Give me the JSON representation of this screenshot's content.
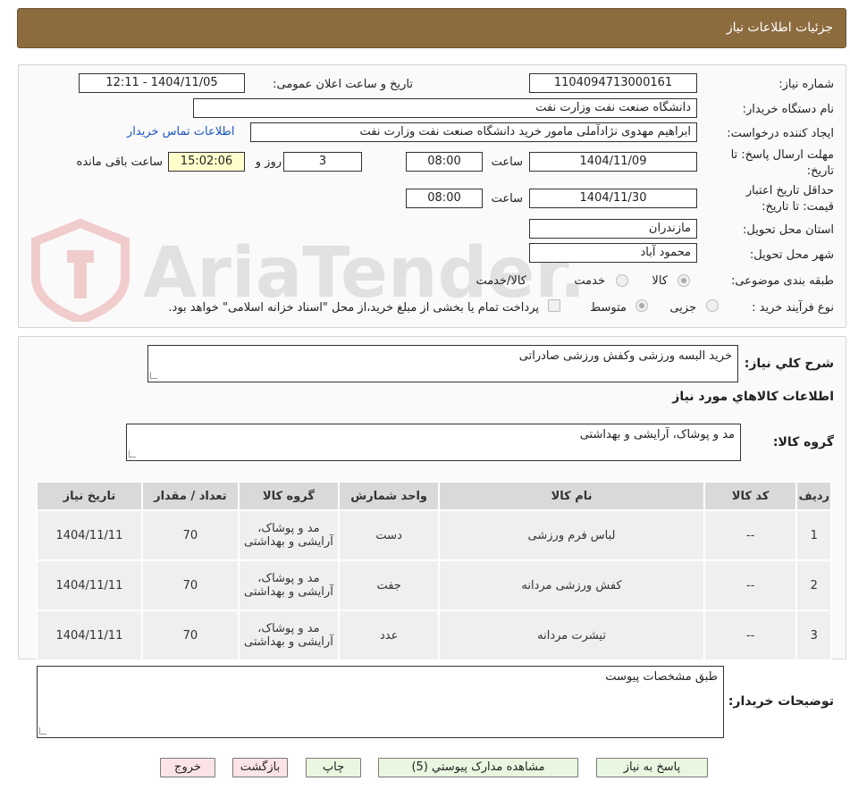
{
  "header": {
    "title": "جزئیات اطلاعات نیاز"
  },
  "form": {
    "need_number_label": "شماره نیاز:",
    "need_number": "1104094713000161",
    "announce_label": "تاریخ و ساعت اعلان عمومی:",
    "announce_value": "1404/11/05 - 12:11",
    "buyer_org_label": "نام دستگاه خریدار:",
    "buyer_org": "دانشگاه صنعت نفت وزارت نفت",
    "creator_label": "ایجاد کننده درخواست:",
    "creator": "ابراهیم مهدوی نژادآملی مامور خرید دانشگاه صنعت نفت وزارت نفت",
    "contact_link": "اطلاعات تماس خریدار",
    "reply_deadline_label_1": "مهلت ارسال پاسخ: تا",
    "reply_deadline_label_2": "تاریخ:",
    "reply_date": "1404/11/09",
    "time_label": "ساعت",
    "reply_time": "08:00",
    "days": "3",
    "days_label": "روز و",
    "remaining_time": "15:02:06",
    "remaining_label": "ساعت باقی مانده",
    "validity_label_1": "حداقل تاریخ اعتبار",
    "validity_label_2": "قیمت: تا تاریخ:",
    "validity_date": "1404/11/30",
    "validity_time": "08:00",
    "province_label": "استان محل تحویل:",
    "province": "مازندران",
    "city_label": "شهر محل تحویل:",
    "city": "محمود آباد",
    "category_label": "طبقه بندی موضوعی:",
    "category_options": [
      "کالا",
      "خدمت",
      "کالا/خدمت"
    ],
    "process_label": "نوع فرآیند خرید :",
    "process_options": [
      "جزیی",
      "متوسط"
    ],
    "payment_note": "پرداخت تمام یا بخشی از مبلغ خرید،از محل \"اسناد خزانه اسلامی\" خواهد بود."
  },
  "summary": {
    "label": "شرح کلي نياز:",
    "value": "خرید البسه ورزشی وکفش ورزشی صادراتی"
  },
  "goods_info": {
    "title": "اطلاعات کالاهاي مورد نياز",
    "group_label": "گروه کالا:",
    "group_value": "مد و پوشاک، آرایشی و بهداشتی"
  },
  "table": {
    "headers": [
      "ردیف",
      "کد کالا",
      "نام کالا",
      "واحد شمارش",
      "گروه کالا",
      "تعداد / مقدار",
      "تاریخ نیاز"
    ],
    "rows": [
      [
        "1",
        "--",
        "لباس فرم ورزشی",
        "دست",
        "مد و پوشاک، آرایشی و بهداشتی",
        "70",
        "1404/11/11"
      ],
      [
        "2",
        "--",
        "کفش ورزشی مردانه",
        "جفت",
        "مد و پوشاک، آرایشی و بهداشتی",
        "70",
        "1404/11/11"
      ],
      [
        "3",
        "--",
        "تیشرت مردانه",
        "عدد",
        "مد و پوشاک، آرایشی و بهداشتی",
        "70",
        "1404/11/11"
      ]
    ]
  },
  "buyer_notes": {
    "label": "توضیحات خریدار:",
    "value": "طبق مشخصات پیوست"
  },
  "buttons": {
    "reply": "پاسخ به نیاز",
    "attachments": "مشاهده مدارک پیوستي (5)",
    "print": "چاپ",
    "back": "بازگشت",
    "exit": "خروج"
  },
  "watermark": {
    "text": "AriaTender.neT"
  },
  "colors": {
    "header_bg": "#8c6b3f",
    "link": "#1a55c4",
    "remaining_bg": "#ffffcc",
    "button_green": "#eaf7e0",
    "button_pink": "#fbe3e6"
  }
}
